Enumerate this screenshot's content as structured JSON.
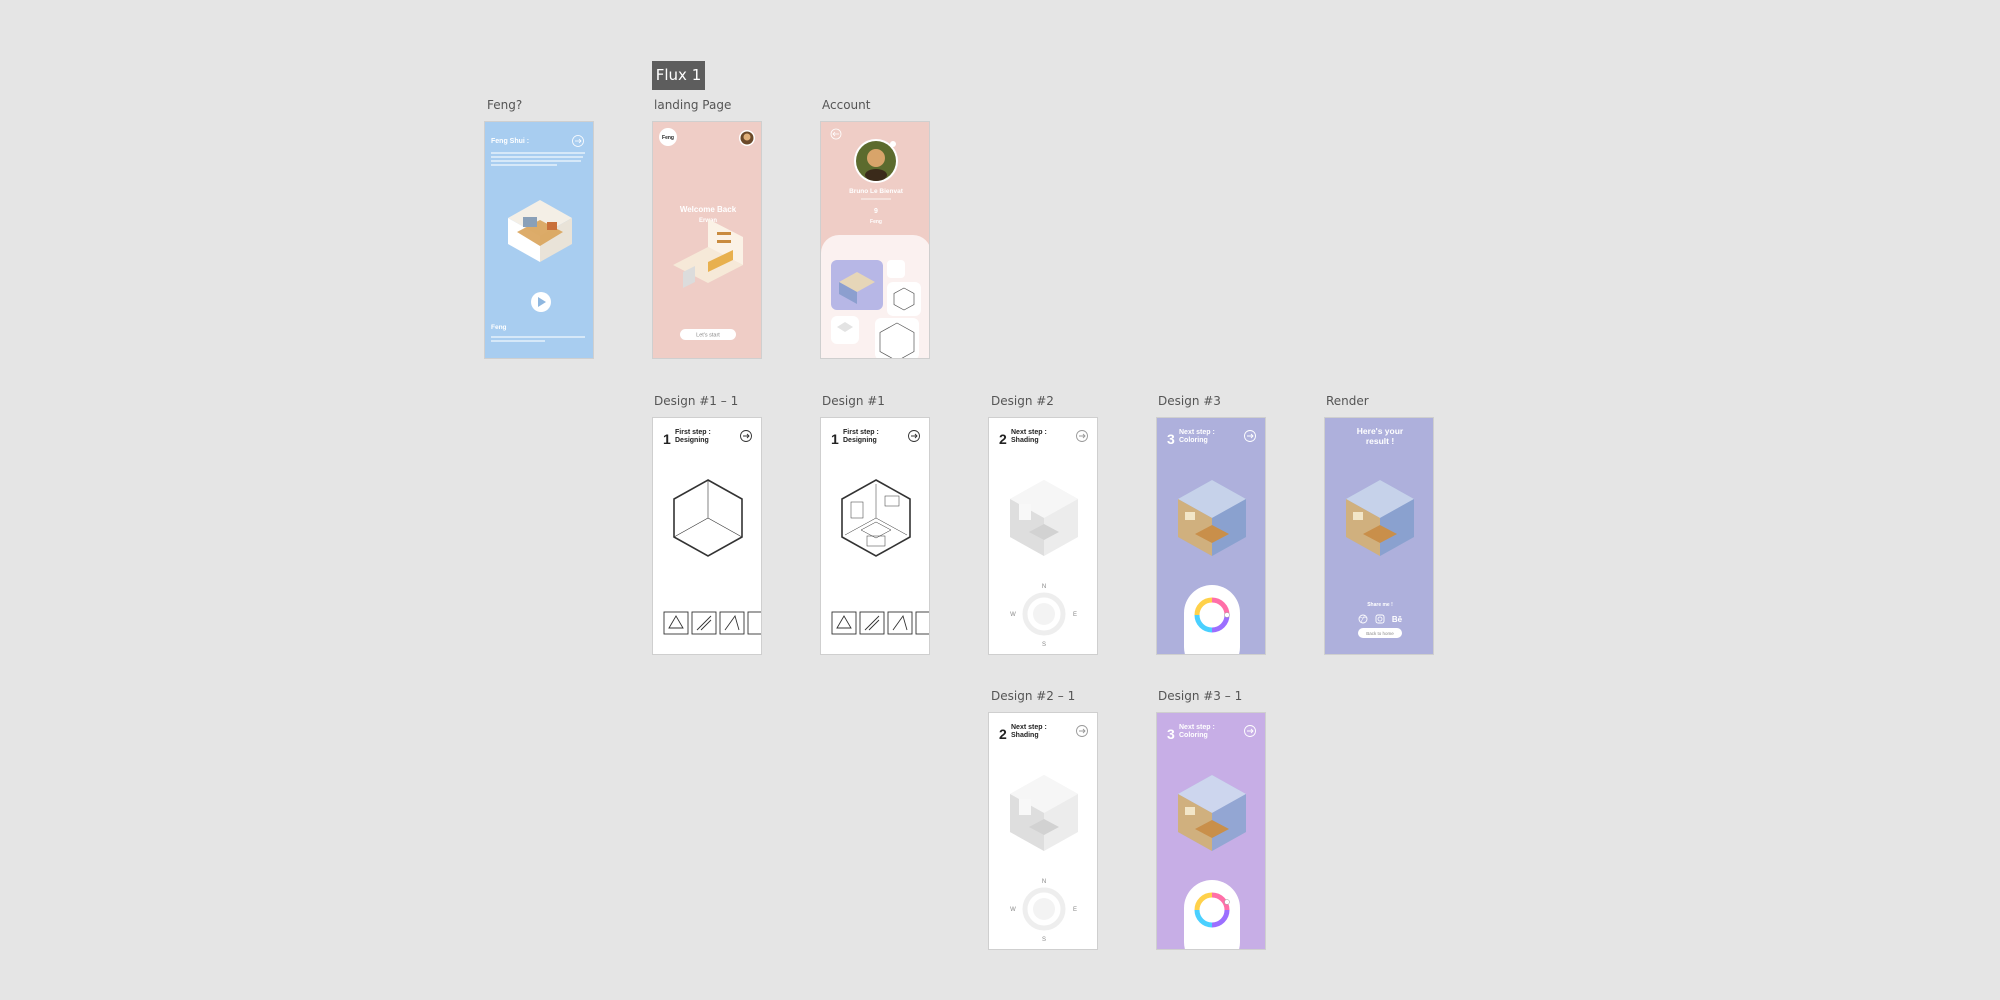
{
  "canvas": {
    "background": "#e5e5e5",
    "flow_tag": "Flux 1"
  },
  "frames": {
    "feng": {
      "label": "Feng?",
      "bg": "#a8cdf0",
      "title": "Feng Shui :",
      "footer_title": "Feng"
    },
    "landing": {
      "label": "landing Page",
      "bg": "#efcdc6",
      "logo": "Feng",
      "welcome": "Welcome Back",
      "name": "Erwan",
      "cta": "Let's start"
    },
    "account": {
      "label": "Account",
      "bg": "#efcdc6",
      "user_name": "Bruno Le Bienvat",
      "count": "9",
      "count_label": "Feng"
    },
    "design1_1": {
      "label": "Design #1 – 1",
      "step_number": "1",
      "step_line1": "First step :",
      "step_line2": "Designing"
    },
    "design1": {
      "label": "Design #1",
      "step_number": "1",
      "step_line1": "First step :",
      "step_line2": "Designing"
    },
    "design2": {
      "label": "Design #2",
      "step_number": "2",
      "step_line1": "Next step :",
      "step_line2": "Shading",
      "compass": {
        "n": "N",
        "e": "E",
        "s": "S",
        "w": "W"
      }
    },
    "design3": {
      "label": "Design #3",
      "bg": "#aeb0dc",
      "step_number": "3",
      "step_line1": "Next step :",
      "step_line2": "Coloring"
    },
    "render": {
      "label": "Render",
      "bg": "#aeb0dc",
      "title_line1": "Here's your",
      "title_line2": "result !",
      "share": "Share me !",
      "behance": "Bē",
      "back": "Back to home"
    },
    "design2_1": {
      "label": "Design #2 – 1",
      "step_number": "2",
      "step_line1": "Next step :",
      "step_line2": "Shading",
      "compass": {
        "n": "N",
        "e": "E",
        "s": "S",
        "w": "W"
      }
    },
    "design3_1": {
      "label": "Design #3 – 1",
      "bg": "#c7aee6",
      "step_number": "3",
      "step_line1": "Next step :",
      "step_line2": "Coloring"
    }
  }
}
